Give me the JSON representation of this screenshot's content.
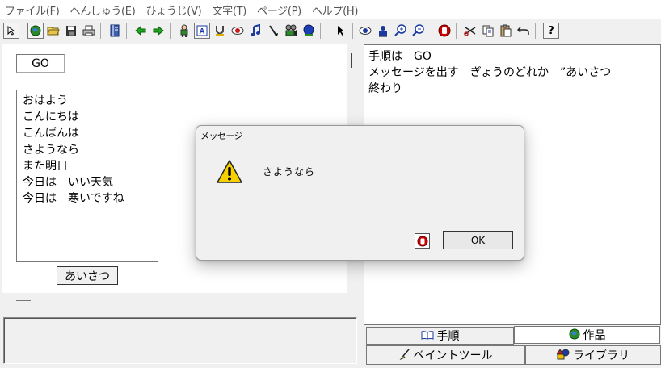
{
  "menu": {
    "items": [
      "ファイル(F)",
      "へんしゅう(E)",
      "ひょうじ(V)",
      "文字(T)",
      "ページ(P)",
      "ヘルプ(H)"
    ]
  },
  "toolbar": {
    "buttons": [
      "cursor-arrow-icon",
      "world-icon",
      "folder-open-icon",
      "save-disk-icon",
      "print-icon",
      "book-icon",
      "arrow-left-icon",
      "arrow-right-icon",
      "character-icon",
      "text-a-icon",
      "magnet-icon",
      "eye-red-icon",
      "music-note-icon",
      "pen-icon",
      "movie-icon",
      "blue-sphere-icon",
      "pointer-icon",
      "eye-icon",
      "person-stamp-icon",
      "zoom-in-icon",
      "zoom-out-icon",
      "stop-hand-icon",
      "scissors-icon",
      "copy-icon",
      "paste-icon",
      "undo-icon",
      "help-icon"
    ],
    "help_label": "?"
  },
  "left": {
    "label": "GO",
    "list_items": [
      "おはよう",
      "こんにちは",
      "こんばんは",
      "さようなら",
      "また明日",
      "今日は　いい天気",
      "今日は　寒いですね"
    ],
    "button_label": "あいさつ"
  },
  "script": {
    "lines": [
      "手順は　GO",
      "メッセージを出す　ぎょうのどれか　”あいさつ",
      "終わり"
    ]
  },
  "tabs": {
    "procedure": "手順",
    "work": "作品",
    "paint": "ペイントツール",
    "library": "ライブラリ"
  },
  "dialog": {
    "title": "メッセージ",
    "message": "さようなら",
    "ok_label": "OK"
  },
  "colors": {
    "warning_yellow": "#f7d000",
    "stop_red": "#cc0000"
  }
}
